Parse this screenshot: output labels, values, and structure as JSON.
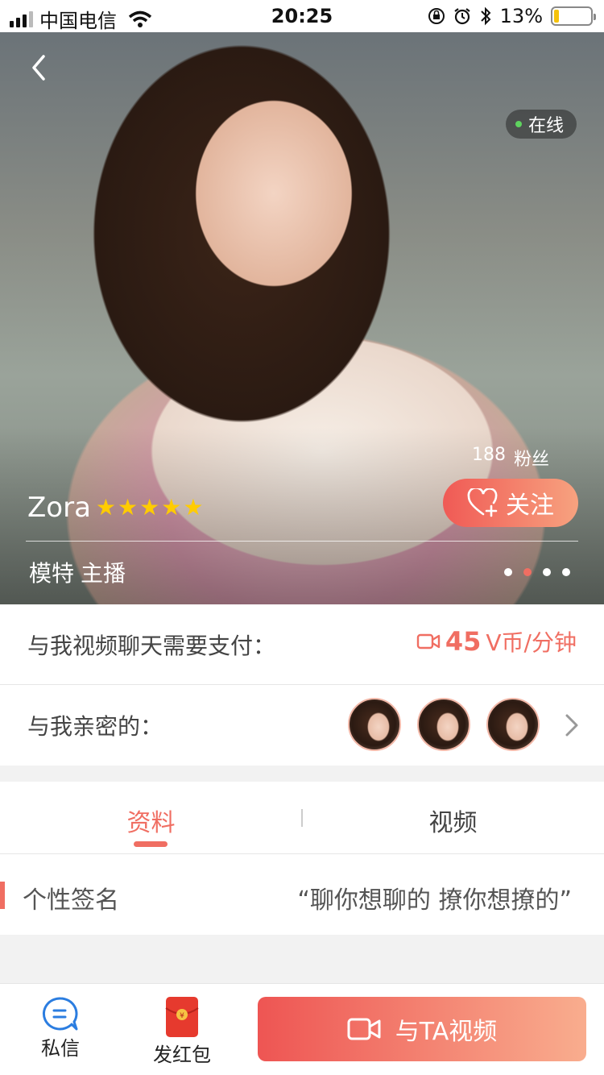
{
  "status_bar": {
    "carrier": "中国电信",
    "time": "20:25",
    "battery_percent": "13%",
    "battery_level": 0.13
  },
  "profile": {
    "online_label": "在线",
    "fans_count": "188",
    "fans_label": "粉丝",
    "follow_label": "关注",
    "name": "Zora",
    "star_rating": 5,
    "tags": [
      "模特",
      "主播"
    ],
    "photo_count": 4,
    "active_photo_index": 1
  },
  "price": {
    "label": "与我视频聊天需要支付：",
    "amount": "45",
    "unit": "V币/分钟"
  },
  "intimate": {
    "label": "与我亲密的：",
    "avatar_count": 3
  },
  "tabs": {
    "profile": "资料",
    "video": "视频"
  },
  "signature": {
    "label": "个性签名",
    "value": "“聊你想聊的 撩你想撩的”"
  },
  "bottom": {
    "message_label": "私信",
    "red_packet_label": "发红包",
    "video_call_label": "与TA视频"
  },
  "colors": {
    "accent": "#f06e62",
    "online": "#5fd35f",
    "star": "#ffcc00"
  }
}
